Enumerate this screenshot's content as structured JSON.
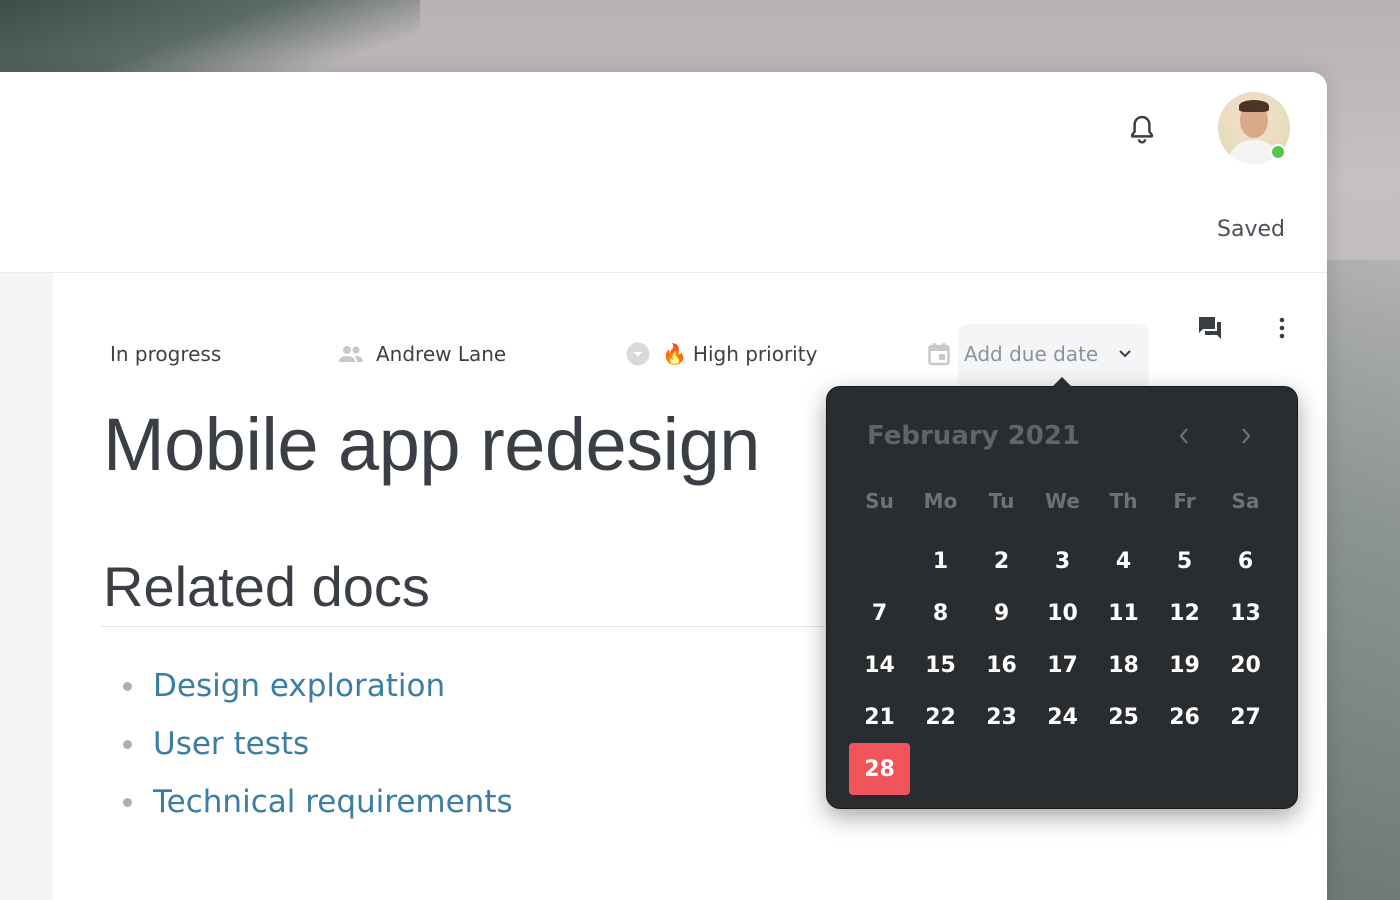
{
  "header": {
    "saved_status": "Saved",
    "notification_icon": "bell-icon",
    "avatar_status_color": "#5ac24f"
  },
  "toolbar": {
    "comments_icon": "comments-icon",
    "more_icon": "more-vertical-icon"
  },
  "properties": {
    "status": "In progress",
    "assignee": "Andrew Lane",
    "priority_emoji": "🔥",
    "priority": "High priority",
    "due_date_placeholder": "Add due date"
  },
  "page": {
    "title": "Mobile app redesign",
    "section_heading": "Related docs",
    "related_docs": [
      "Design exploration",
      "User tests",
      "Technical requirements"
    ]
  },
  "calendar": {
    "month_label": "February 2021",
    "weekdays": [
      "Su",
      "Mo",
      "Tu",
      "We",
      "Th",
      "Fr",
      "Sa"
    ],
    "first_weekday_offset": 1,
    "days": [
      "1",
      "2",
      "3",
      "4",
      "5",
      "6",
      "7",
      "8",
      "9",
      "10",
      "11",
      "12",
      "13",
      "14",
      "15",
      "16",
      "17",
      "18",
      "19",
      "20",
      "21",
      "22",
      "23",
      "24",
      "25",
      "26",
      "27",
      "28"
    ],
    "selected_day": "28",
    "selected_color": "#f2545b"
  },
  "colors": {
    "link": "#3b7ea4",
    "calendar_bg": "#2a2d30"
  }
}
